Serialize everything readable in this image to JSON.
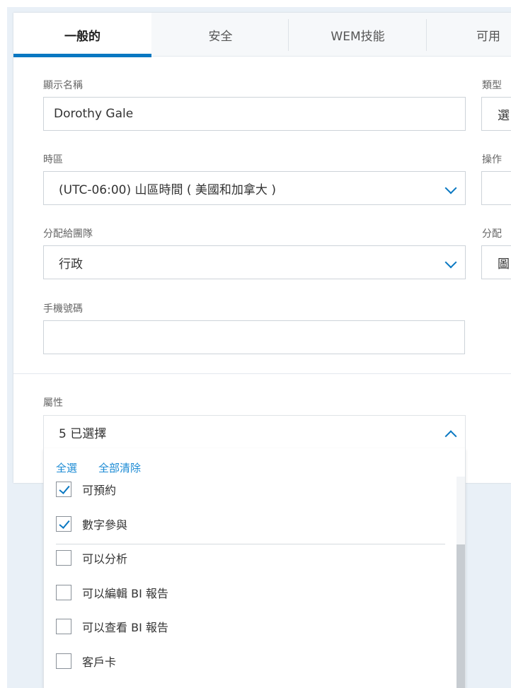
{
  "tabs": [
    {
      "label": "一般的",
      "active": true
    },
    {
      "label": "安全"
    },
    {
      "label": "WEM技能"
    },
    {
      "label": "可用"
    }
  ],
  "fields": {
    "display_name": {
      "label": "顯示名稱",
      "value": "Dorothy Gale"
    },
    "timezone": {
      "label": "時區",
      "value": "(UTC-06:00) 山區時間 ( 美國和加拿大 )"
    },
    "team": {
      "label": "分配給團隊",
      "value": "行政"
    },
    "mobile": {
      "label": "手機號碼",
      "value": ""
    },
    "type": {
      "label": "類型",
      "value": "選"
    },
    "operation": {
      "label": "操作",
      "value": ""
    },
    "assign": {
      "label": "分配",
      "value": "圖"
    },
    "attributes": {
      "label": "屬性",
      "value": "5 已選擇"
    }
  },
  "dropdown": {
    "select_all": "全選",
    "clear_all": "全部清除",
    "options": [
      {
        "label": "可預約",
        "checked": true
      },
      {
        "label": "數字參與",
        "checked": true
      },
      {
        "label": "可以分析",
        "checked": false
      },
      {
        "label": "可以編輯 BI 報告",
        "checked": false
      },
      {
        "label": "可以查看 BI 報告",
        "checked": false
      },
      {
        "label": "客戶卡",
        "checked": false
      }
    ]
  },
  "colors": {
    "accent": "#0a78c2",
    "background": "#e9f0f7"
  }
}
